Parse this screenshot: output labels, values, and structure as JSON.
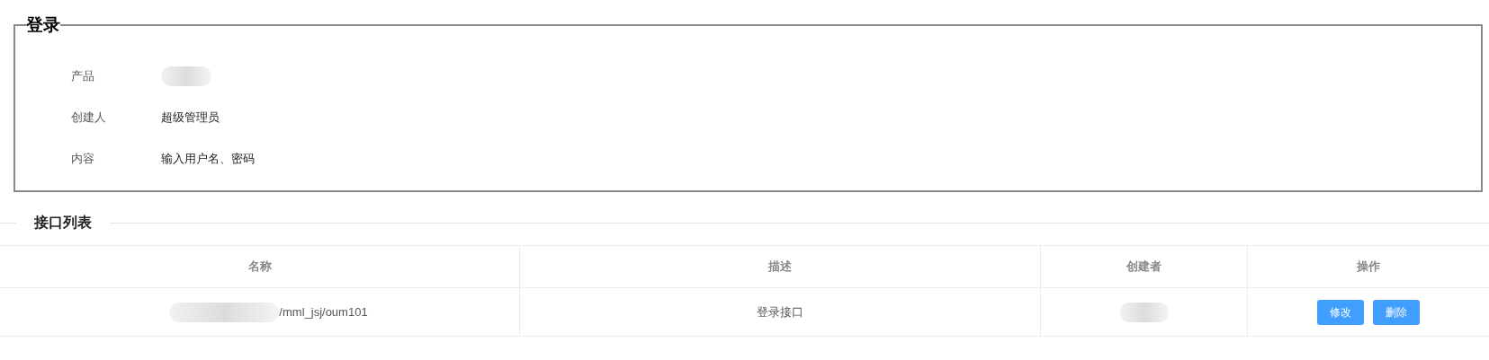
{
  "detail": {
    "title": "登录",
    "fields": [
      {
        "label": "产品",
        "redacted": true
      },
      {
        "label": "创建人",
        "value": "超级管理员",
        "redacted": false
      },
      {
        "label": "内容",
        "value": "输入用户名、密码",
        "redacted": false
      }
    ]
  },
  "section": {
    "title": "接口列表"
  },
  "table": {
    "columns": [
      "名称",
      "描述",
      "创建者",
      "操作"
    ],
    "rows": [
      {
        "name": "/mml_jsj/oum101",
        "name_redacted": true,
        "description": "登录接口",
        "creator_redacted": true,
        "actions": [
          "修改",
          "删除"
        ]
      }
    ]
  }
}
